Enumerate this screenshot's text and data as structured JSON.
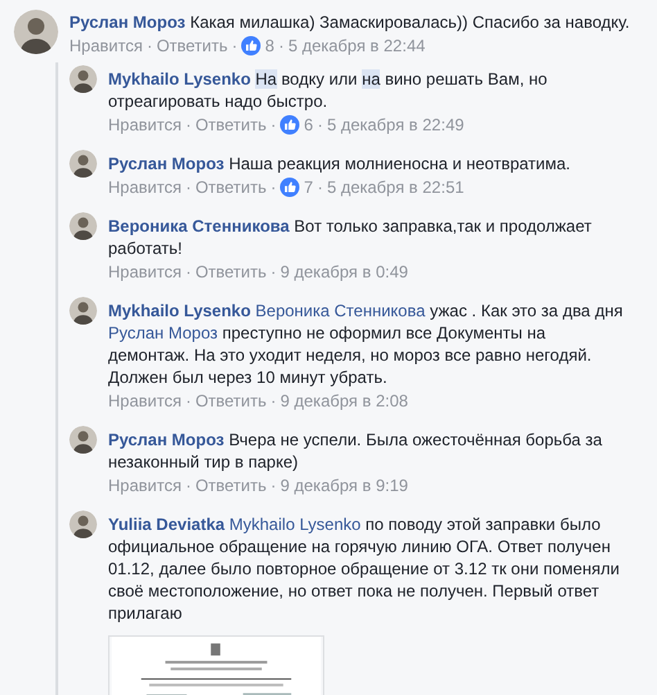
{
  "comment": {
    "author": "Руслан Мороз",
    "text": [
      {
        "kind": "plain",
        "text": "Какая милашка) Замаскировалась)) Спасибо за наводку."
      }
    ],
    "actions": [
      {
        "kind": "like",
        "text": "Нравится"
      },
      {
        "kind": "dot",
        "text": "·"
      },
      {
        "kind": "reply",
        "text": "Ответить"
      },
      {
        "kind": "dot",
        "text": "·"
      },
      {
        "kind": "likes",
        "text": "8"
      },
      {
        "kind": "dot",
        "text": "·"
      },
      {
        "kind": "time",
        "text": "5 декабря в 22:44"
      }
    ]
  },
  "replies": [
    {
      "author": "Mykhailo Lysenko",
      "text": [
        {
          "kind": "highlight",
          "text": "На"
        },
        {
          "kind": "plain",
          "text": " водку или "
        },
        {
          "kind": "highlight",
          "text": "на"
        },
        {
          "kind": "plain",
          "text": " вино решать Вам, но отреагировать надо быстро."
        }
      ],
      "actions": [
        {
          "kind": "like",
          "text": "Нравится"
        },
        {
          "kind": "dot",
          "text": "·"
        },
        {
          "kind": "reply",
          "text": "Ответить"
        },
        {
          "kind": "dot",
          "text": "·"
        },
        {
          "kind": "likes",
          "text": "6"
        },
        {
          "kind": "dot",
          "text": "·"
        },
        {
          "kind": "time",
          "text": "5 декабря в 22:49"
        }
      ]
    },
    {
      "author": "Руслан Мороз",
      "text": [
        {
          "kind": "plain",
          "text": "Наша реакция молниеносна и неотвратима."
        }
      ],
      "actions": [
        {
          "kind": "like",
          "text": "Нравится"
        },
        {
          "kind": "dot",
          "text": "·"
        },
        {
          "kind": "reply",
          "text": "Ответить"
        },
        {
          "kind": "dot",
          "text": "·"
        },
        {
          "kind": "likes",
          "text": "7"
        },
        {
          "kind": "dot",
          "text": "·"
        },
        {
          "kind": "time",
          "text": "5 декабря в 22:51"
        }
      ]
    },
    {
      "author": "Вероника Стенникова",
      "text": [
        {
          "kind": "plain",
          "text": "Вот только заправка,так и продолжает работать!"
        }
      ],
      "actions": [
        {
          "kind": "like",
          "text": "Нравится"
        },
        {
          "kind": "dot",
          "text": "·"
        },
        {
          "kind": "reply",
          "text": "Ответить"
        },
        {
          "kind": "dot",
          "text": "·"
        },
        {
          "kind": "time",
          "text": "9 декабря в 0:49"
        }
      ]
    },
    {
      "author": "Mykhailo Lysenko",
      "text": [
        {
          "kind": "mention",
          "text": "Вероника Стенникова"
        },
        {
          "kind": "plain",
          "text": " ужас . Как это за два дня "
        },
        {
          "kind": "mention",
          "text": "Руслан Мороз"
        },
        {
          "kind": "plain",
          "text": " преступно не оформил все Документы на демонтаж. На это уходит неделя, но мороз все равно негодяй. Должен был через 10 минут убрать."
        }
      ],
      "actions": [
        {
          "kind": "like",
          "text": "Нравится"
        },
        {
          "kind": "dot",
          "text": "·"
        },
        {
          "kind": "reply",
          "text": "Ответить"
        },
        {
          "kind": "dot",
          "text": "·"
        },
        {
          "kind": "time",
          "text": "9 декабря в 2:08"
        }
      ]
    },
    {
      "author": "Руслан Мороз",
      "text": [
        {
          "kind": "plain",
          "text": "Вчера не успели. Была ожесточённая борьба за незаконный тир в парке)"
        }
      ],
      "actions": [
        {
          "kind": "like",
          "text": "Нравится"
        },
        {
          "kind": "dot",
          "text": "·"
        },
        {
          "kind": "reply",
          "text": "Ответить"
        },
        {
          "kind": "dot",
          "text": "·"
        },
        {
          "kind": "time",
          "text": "9 декабря в 9:19"
        }
      ]
    },
    {
      "author": "Yuliia Deviatka",
      "text": [
        {
          "kind": "mention",
          "text": "Mykhailo Lysenko"
        },
        {
          "kind": "plain",
          "text": " по поводу этой заправки было официальное обращение на горячую линию ОГА. Ответ получен 01.12, далее было повторное обращение от 3.12 тк они поменяли своё местоположение, но ответ пока не получен. Первый ответ прилагаю"
        }
      ]
    }
  ]
}
